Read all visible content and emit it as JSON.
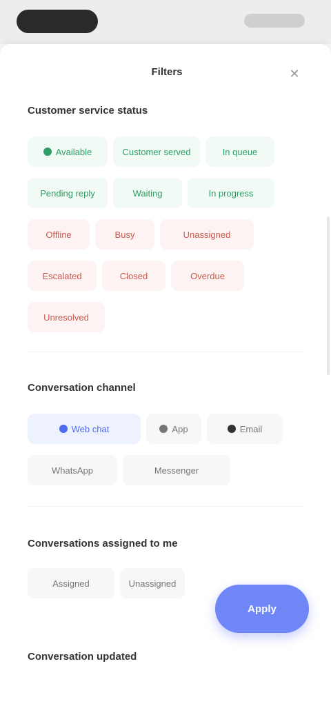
{
  "sheet": {
    "title": "Filters"
  },
  "sections": {
    "status": {
      "title": "Customer service status",
      "chips_green": [
        "Available",
        "Customer served",
        "In queue",
        "Pending reply",
        "Waiting",
        "In progress"
      ],
      "chips_red": [
        "Offline",
        "Busy",
        "Unassigned",
        "Escalated",
        "Closed",
        "Overdue",
        "Unresolved"
      ]
    },
    "conversation": {
      "title": "Conversation channel",
      "chips": [
        "Web chat",
        "App",
        "Email",
        "WhatsApp",
        "Messenger"
      ]
    },
    "assigned": {
      "title": "Conversations assigned to me",
      "chips": [
        "Assigned",
        "Unassigned"
      ]
    },
    "date": {
      "title": "Conversation updated"
    }
  },
  "actions": {
    "apply": "Apply"
  },
  "icons": {
    "close": "close-icon"
  },
  "colors": {
    "accent": "#6f86f7",
    "green": "#2e9e64",
    "red": "#c85a50"
  }
}
